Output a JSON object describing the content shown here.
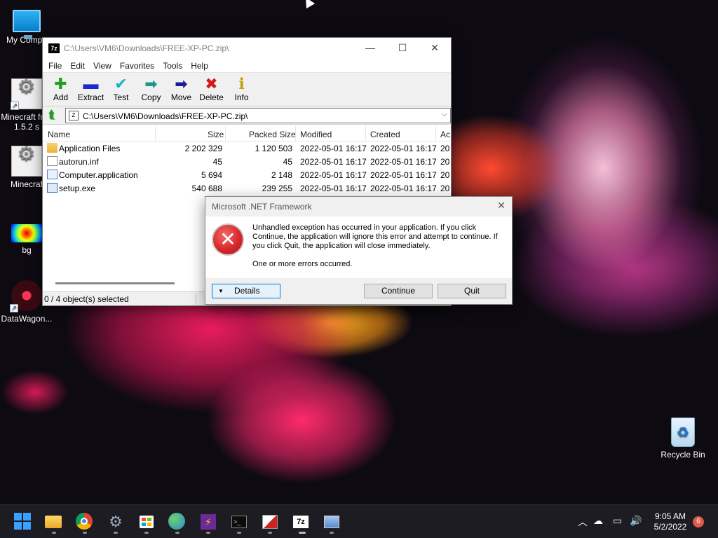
{
  "desktop": {
    "icons": [
      {
        "label": "My Compu"
      },
      {
        "label": "Minecraft free 1.5.2 s"
      },
      {
        "label": "Minecraf"
      },
      {
        "label": "bg"
      },
      {
        "label": "DataWagon..."
      },
      {
        "label": "Recycle Bin"
      }
    ]
  },
  "zip_window": {
    "title": "C:\\Users\\VM6\\Downloads\\FREE-XP-PC.zip\\",
    "app_icon": "7z",
    "menu": [
      "File",
      "Edit",
      "View",
      "Favorites",
      "Tools",
      "Help"
    ],
    "toolbar": [
      {
        "label": "Add",
        "icon": "plus-icon",
        "color": "#1aa01a"
      },
      {
        "label": "Extract",
        "icon": "minus-icon",
        "color": "#1a2ad0"
      },
      {
        "label": "Test",
        "icon": "check-icon",
        "color": "#16b0c8"
      },
      {
        "label": "Copy",
        "icon": "copy-arrow-icon",
        "color": "#1a9a8a"
      },
      {
        "label": "Move",
        "icon": "move-arrow-icon",
        "color": "#1a1aa0"
      },
      {
        "label": "Delete",
        "icon": "x-icon",
        "color": "#d01a1a"
      },
      {
        "label": "Info",
        "icon": "info-icon",
        "color": "#c8a000"
      }
    ],
    "address": "C:\\Users\\VM6\\Downloads\\FREE-XP-PC.zip\\",
    "columns": [
      "Name",
      "Size",
      "Packed Size",
      "Modified",
      "Created",
      "Ac"
    ],
    "rows": [
      {
        "name": "Application Files",
        "size": "2 202 329",
        "packed": "1 120 503",
        "modified": "2022-05-01 16:17",
        "created": "2022-05-01 16:17",
        "ac": "20"
      },
      {
        "name": "autorun.inf",
        "size": "45",
        "packed": "45",
        "modified": "2022-05-01 16:17",
        "created": "2022-05-01 16:17",
        "ac": "20"
      },
      {
        "name": "Computer.application",
        "size": "5 694",
        "packed": "2 148",
        "modified": "2022-05-01 16:17",
        "created": "2022-05-01 16:17",
        "ac": "20"
      },
      {
        "name": "setup.exe",
        "size": "540 688",
        "packed": "239 255",
        "modified": "2022-05-01 16:17",
        "created": "2022-05-01 16:17",
        "ac": "20"
      }
    ],
    "status": "0 / 4 object(s) selected"
  },
  "dialog": {
    "title": "Microsoft .NET Framework",
    "message": "Unhandled exception has occurred in your application. If you click Continue, the application will ignore this error and attempt to continue. If you click Quit, the application will close immediately.",
    "detail": "One or more errors occurred.",
    "details_btn": "Details",
    "continue_btn": "Continue",
    "quit_btn": "Quit"
  },
  "taskbar": {
    "time": "9:05 AM",
    "date": "5/2/2022",
    "notifications": "6"
  }
}
